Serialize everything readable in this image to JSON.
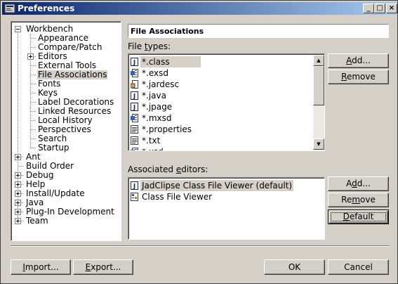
{
  "window": {
    "title": "Preferences"
  },
  "titlebar_buttons": {
    "minimize": "_",
    "maximize": "□",
    "close": "×"
  },
  "tree": {
    "workbench": "Workbench",
    "workbench_children": [
      "Appearance",
      "Compare/Patch",
      "Editors",
      "External Tools",
      "File Associations",
      "Fonts",
      "Keys",
      "Label Decorations",
      "Linked Resources",
      "Local History",
      "Perspectives",
      "Search",
      "Startup"
    ],
    "roots": [
      "Ant",
      "Build Order",
      "Debug",
      "Help",
      "Install/Update",
      "Java",
      "Plug-In Development",
      "Team"
    ],
    "selected": "File Associations"
  },
  "page": {
    "title": "File Associations",
    "file_types_label": "File types:",
    "file_types_mnemonic": "t",
    "file_types": [
      ".class",
      ".exsd",
      ".jardesc",
      ".java",
      ".jpage",
      ".mxsd",
      ".properties",
      ".txt",
      ".xsd"
    ],
    "file_type_prefix": "*",
    "file_type_icons": [
      "java-class-file-icon",
      "schema-file-icon",
      "jar-description-file-icon",
      "java-source-file-icon",
      "java-page-file-icon",
      "schema-file-icon",
      "properties-file-icon",
      "text-file-icon",
      "schema-file-icon"
    ],
    "associated_editors_label": "Associated editors:",
    "associated_editors": [
      {
        "label": "JadClipse Class File Viewer (default)",
        "icon": "jadclipse-editor-icon"
      },
      {
        "label": "Class File Viewer",
        "icon": "class-file-viewer-icon"
      }
    ]
  },
  "buttons": {
    "add": "Add...",
    "remove": "Remove",
    "add2": "Add...",
    "remove2": "Remove",
    "default": "Default",
    "import": "Import...",
    "export": "Export...",
    "ok": "OK",
    "cancel": "Cancel"
  }
}
